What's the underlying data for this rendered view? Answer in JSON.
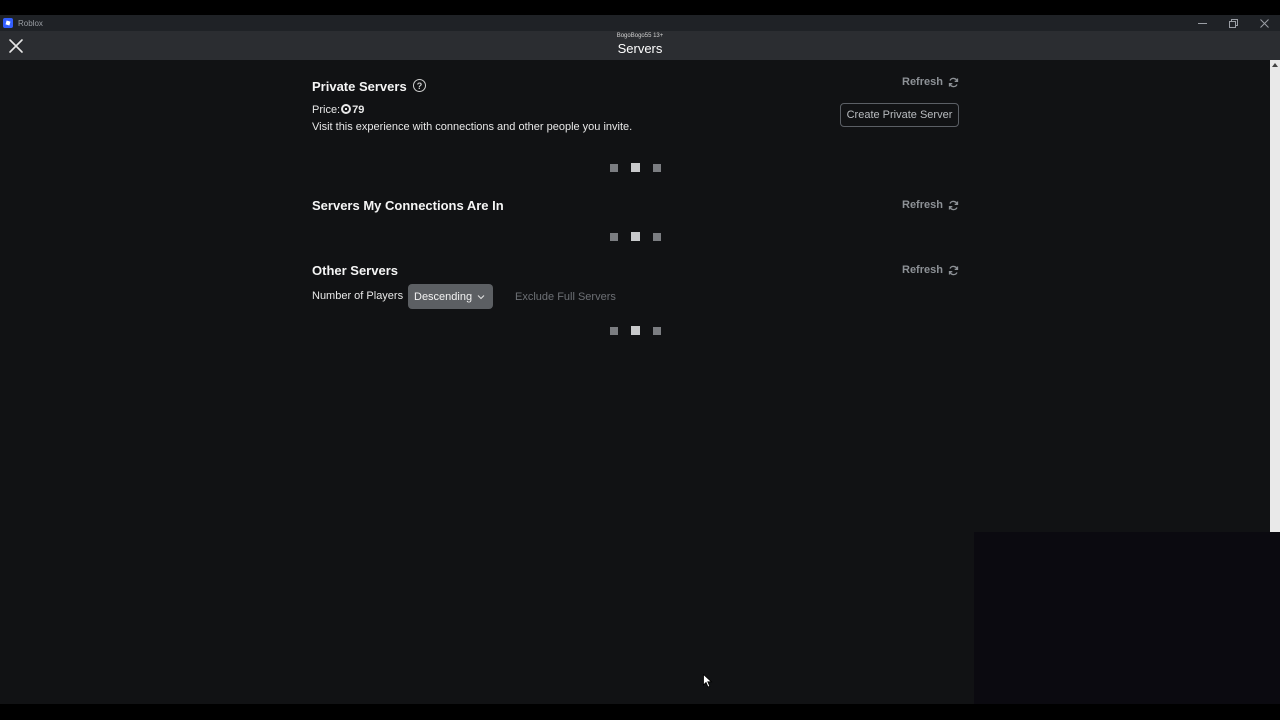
{
  "window": {
    "title": "Roblox",
    "controls": [
      "minimize",
      "restore",
      "close"
    ]
  },
  "header": {
    "username": "BogoBogo55 13+",
    "title": "Servers"
  },
  "private_servers": {
    "title": "Private Servers",
    "refresh_label": "Refresh",
    "price_label": "Price:",
    "price_value": "79",
    "description": "Visit this experience with connections and other people you invite.",
    "create_button_label": "Create Private Server"
  },
  "connections_servers": {
    "title": "Servers My Connections Are In",
    "refresh_label": "Refresh"
  },
  "other_servers": {
    "title": "Other Servers",
    "refresh_label": "Refresh",
    "sort_label": "Number of Players",
    "sort_value": "Descending",
    "exclude_label": "Exclude Full Servers"
  },
  "colors": {
    "background": "#111214",
    "header": "#2b2d31",
    "dropdown": "#5c5f63",
    "muted_text": "#8d9196"
  }
}
